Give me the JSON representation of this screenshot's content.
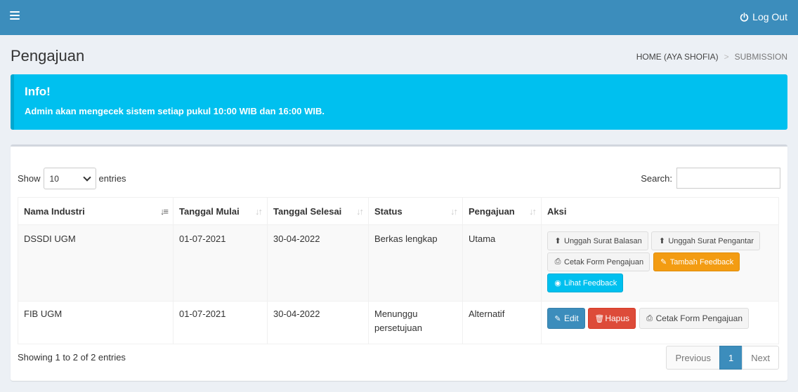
{
  "header": {
    "logout_label": "Log Out",
    "color": "#3c8dbc"
  },
  "page": {
    "title": "Pengajuan"
  },
  "breadcrumb": {
    "home": "HOME (AYA SHOFIA)",
    "separator": ">",
    "current": "SUBMISSION"
  },
  "alert": {
    "title": "Info!",
    "message": "Admin akan mengecek sistem setiap pukul 10:00 WIB dan 16:00 WIB.",
    "color": "#00c0ef"
  },
  "table_controls": {
    "show_label": "Show",
    "entries_label": "entries",
    "page_length": "10",
    "search_label": "Search:",
    "search_value": ""
  },
  "table": {
    "columns": [
      "Nama Industri",
      "Tanggal Mulai",
      "Tanggal Selesai",
      "Status",
      "Pengajuan",
      "Aksi"
    ],
    "rows": [
      {
        "nama": "DSSDI UGM",
        "mulai": "01-07-2021",
        "selesai": "30-04-2022",
        "status": "Berkas lengkap",
        "pengajuan": "Utama",
        "actions": {
          "unggah_balasan": "Unggah Surat Balasan",
          "unggah_pengantar": "Unggah Surat Pengantar",
          "cetak_form": "Cetak Form Pengajuan",
          "tambah_feedback": "Tambah Feedback",
          "lihat_feedback": "Lihat Feedback"
        }
      },
      {
        "nama": "FIB UGM",
        "mulai": "01-07-2021",
        "selesai": "30-04-2022",
        "status": "Menunggu persetujuan",
        "pengajuan": "Alternatif",
        "actions": {
          "edit": "Edit",
          "hapus": "Hapus",
          "cetak_form": "Cetak Form Pengajuan"
        }
      }
    ]
  },
  "footer": {
    "info": "Showing 1 to 2 of 2 entries",
    "previous": "Previous",
    "current_page": "1",
    "next": "Next"
  }
}
